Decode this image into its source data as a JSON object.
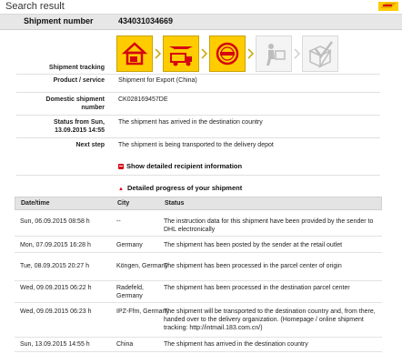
{
  "header": {
    "title": "Search result"
  },
  "shipment": {
    "number_label": "Shipment number",
    "number_value": "434031034669"
  },
  "tracking": {
    "label": "Shipment tracking",
    "steps": [
      {
        "icon": "house-icon",
        "state": "active"
      },
      {
        "icon": "airplane-truck-icon",
        "state": "active"
      },
      {
        "icon": "customs-stamp-icon",
        "state": "active"
      },
      {
        "icon": "courier-icon",
        "state": "inactive"
      },
      {
        "icon": "delivered-box-icon",
        "state": "inactive"
      }
    ]
  },
  "details": {
    "product_label": "Product / service",
    "product_value": "Shipment for Export (China)",
    "domestic_label": "Domestic shipment number",
    "domestic_value": "CK028169457DE",
    "status_label": "Status from Sun, 13.09.2015 14:55",
    "status_value": "The shipment has arrived in the destination country",
    "next_label": "Next step",
    "next_value": "The shipment is being transported to the delivery depot"
  },
  "toggles": {
    "recipient": "Show detailed recipient information",
    "progress": "Detailed progress of your shipment"
  },
  "table": {
    "headers": {
      "date": "Date/time",
      "city": "City",
      "status": "Status"
    },
    "rows": [
      {
        "date": "Sun, 06.09.2015 08:58 h",
        "city": "--",
        "status": "The instruction data for this shipment have been provided by the sender to DHL electronically"
      },
      {
        "date": "Mon, 07.09.2015 16:28 h",
        "city": "Germany",
        "status": "The shipment has been posted by the sender at the retail outlet"
      },
      {
        "date": "Tue, 08.09.2015 20:27 h",
        "city": "Köngen, Germany",
        "status": "The shipment has been processed in the parcel center of origin"
      },
      {
        "date": "Wed, 09.09.2015 06:22 h",
        "city": "Radefeld, Germany",
        "status": "The shipment has been processed in the destination parcel center"
      },
      {
        "date": "Wed, 09.09.2015 06:23 h",
        "city": "IPZ-Ffm, Germany",
        "status": "The shipment will be transported to the destination country and, from there, handed over to the delivery organization. (Homepage / online shipment tracking: http://intmail.183.com.cn/)"
      },
      {
        "date": "Sun, 13.09.2015 14:55 h",
        "city": "China",
        "status": "The shipment has arrived in the destination country"
      }
    ]
  },
  "colors": {
    "dhl_yellow": "#ffcc00",
    "dhl_red": "#d40511"
  }
}
